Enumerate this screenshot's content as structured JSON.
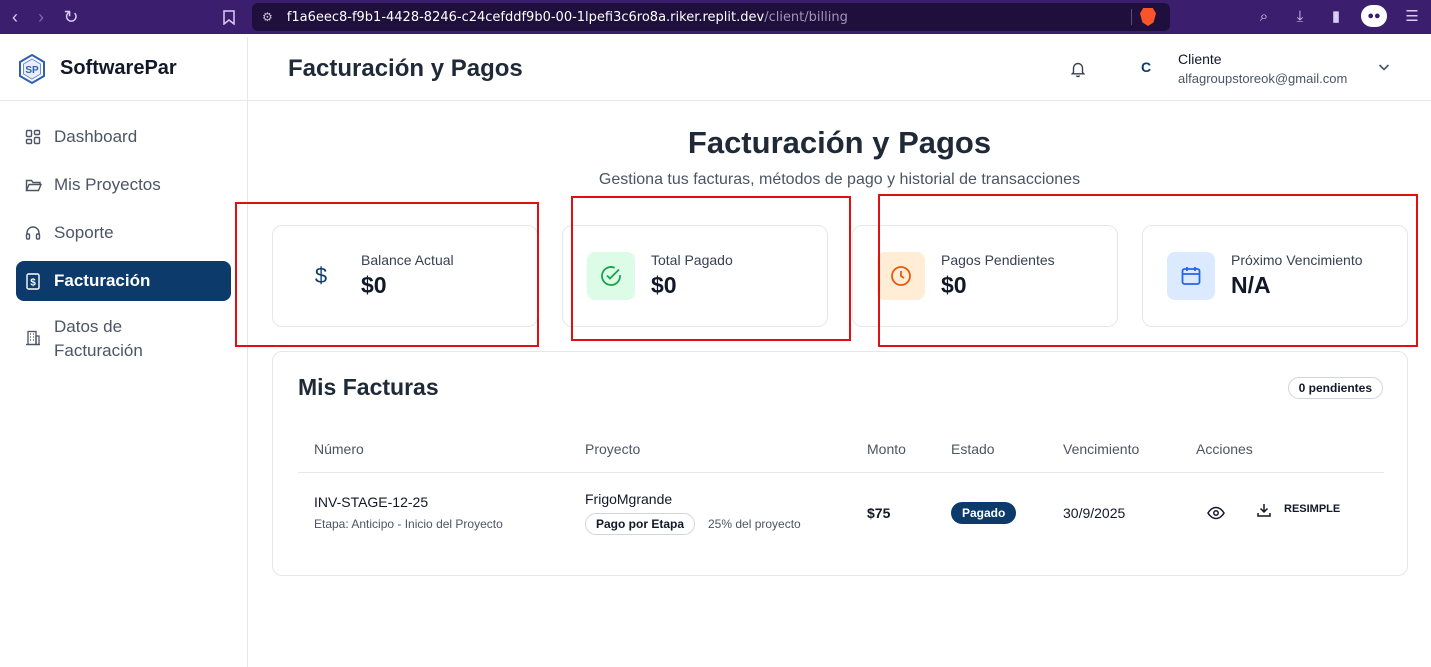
{
  "browser": {
    "url_host": "f1a6eec8-f9b1-4428-8246-c24cefddf9b0-00-1lpefi3c6ro8a.riker.replit.dev",
    "url_path": "/client/billing"
  },
  "brand": {
    "name": "SoftwarePar",
    "logo_text": "SP"
  },
  "sidebar": {
    "items": [
      {
        "label": "Dashboard",
        "icon": "dashboard-grid-icon",
        "active": false
      },
      {
        "label": "Mis Proyectos",
        "icon": "folder-icon",
        "active": false
      },
      {
        "label": "Soporte",
        "icon": "headset-icon",
        "active": false
      },
      {
        "label": "Facturación",
        "icon": "receipt-dollar-icon",
        "active": true
      },
      {
        "label_line1": "Datos de",
        "label_line2": "Facturación",
        "icon": "building-icon",
        "active": false
      }
    ]
  },
  "header": {
    "title": "Facturación y Pagos",
    "avatar_initial": "C",
    "user_name": "Cliente",
    "user_email": "alfagroupstoreok@gmail.com"
  },
  "main": {
    "title": "Facturación y Pagos",
    "subtitle": "Gestiona tus facturas, métodos de pago y historial de transacciones"
  },
  "stats": [
    {
      "label": "Balance Actual",
      "value": "$0",
      "icon": "dollar-icon",
      "icon_color": "#0b3a6b",
      "bg": "#ffffff"
    },
    {
      "label": "Total Pagado",
      "value": "$0",
      "icon": "check-circle-icon",
      "icon_color": "#16a34a",
      "bg": "#dcfce7"
    },
    {
      "label": "Pagos Pendientes",
      "value": "$0",
      "icon": "clock-icon",
      "icon_color": "#ea580c",
      "bg": "#ffedd5"
    },
    {
      "label": "Próximo Vencimiento",
      "value": "N/A",
      "icon": "calendar-icon",
      "icon_color": "#2563eb",
      "bg": "#dbeafe"
    }
  ],
  "invoices": {
    "title": "Mis Facturas",
    "pending_badge": "0 pendientes",
    "columns": [
      "Número",
      "Proyecto",
      "Monto",
      "Estado",
      "Vencimiento",
      "Acciones"
    ],
    "rows": [
      {
        "number": "INV-STAGE-12-25",
        "stage": "Etapa: Anticipo - Inicio del Proyecto",
        "project": "FrigoMgrande",
        "payment_type": "Pago por Etapa",
        "project_percent": "25% del proyecto",
        "amount": "$75",
        "status": "Pagado",
        "due": "30/9/2025",
        "action_label": "RESIMPLE"
      }
    ]
  },
  "colors": {
    "brand_primary": "#0b3a6b",
    "highlight": "#e01010",
    "browser_chrome": "#3b1f6e"
  }
}
